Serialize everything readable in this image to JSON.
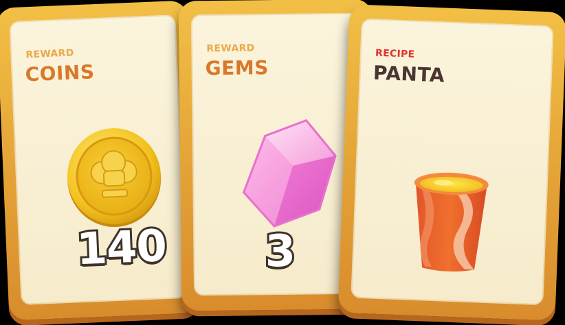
{
  "cards": [
    {
      "kind_label": "REWARD",
      "title": "COINS",
      "amount": "140",
      "icon": "coin-icon"
    },
    {
      "kind_label": "REWARD",
      "title": "GEMS",
      "amount": "3",
      "icon": "gem-icon"
    },
    {
      "kind_label": "RECIPE",
      "title": "PANTA",
      "icon": "drink-cup-icon"
    }
  ],
  "colors": {
    "card_frame": "#e4a236",
    "card_face": "#f8efd2",
    "reward_label": "#e9a94b",
    "title_orange": "#d9782a",
    "recipe_label": "#e2322d",
    "recipe_title": "#4a3532"
  }
}
